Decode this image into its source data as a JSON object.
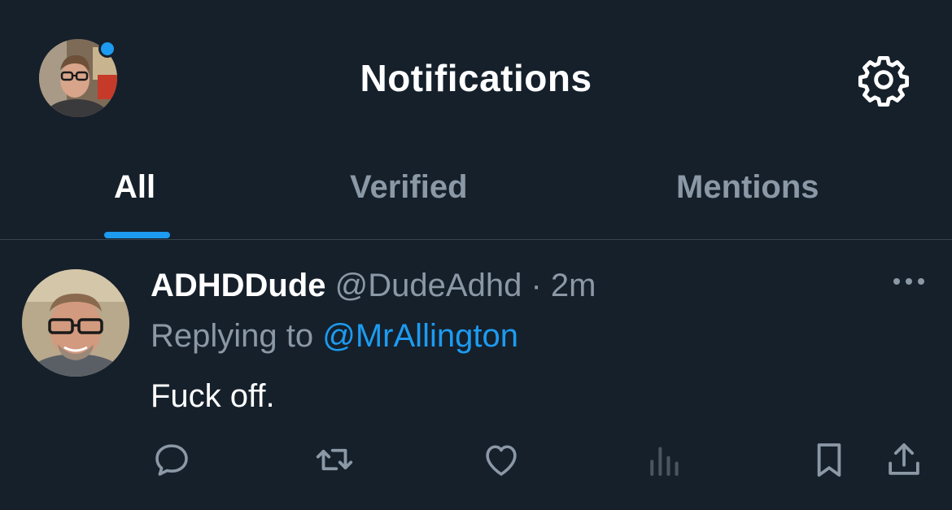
{
  "header": {
    "title": "Notifications",
    "avatar_icon": "user-avatar",
    "settings_icon": "gear-icon",
    "unread_color": "#1d9bf0"
  },
  "tabs": [
    {
      "label": "All",
      "active": true
    },
    {
      "label": "Verified",
      "active": false
    },
    {
      "label": "Mentions",
      "active": false
    }
  ],
  "notification": {
    "author_name": "ADHDDude",
    "author_handle": "@DudeAdhd",
    "separator": "·",
    "time": "2m",
    "replying_prefix": "Replying to",
    "replying_handle": "@MrAllington",
    "text": "Fuck off.",
    "more_icon": "more-dots-icon",
    "actions": [
      {
        "icon": "reply-icon"
      },
      {
        "icon": "retweet-icon"
      },
      {
        "icon": "like-icon"
      },
      {
        "icon": "views-icon"
      },
      {
        "icon": "bookmark-icon"
      },
      {
        "icon": "share-icon"
      }
    ]
  },
  "colors": {
    "background": "#15202b",
    "accent": "#1d9bf0",
    "muted_text": "#8b98a5",
    "divider": "#38444d"
  }
}
